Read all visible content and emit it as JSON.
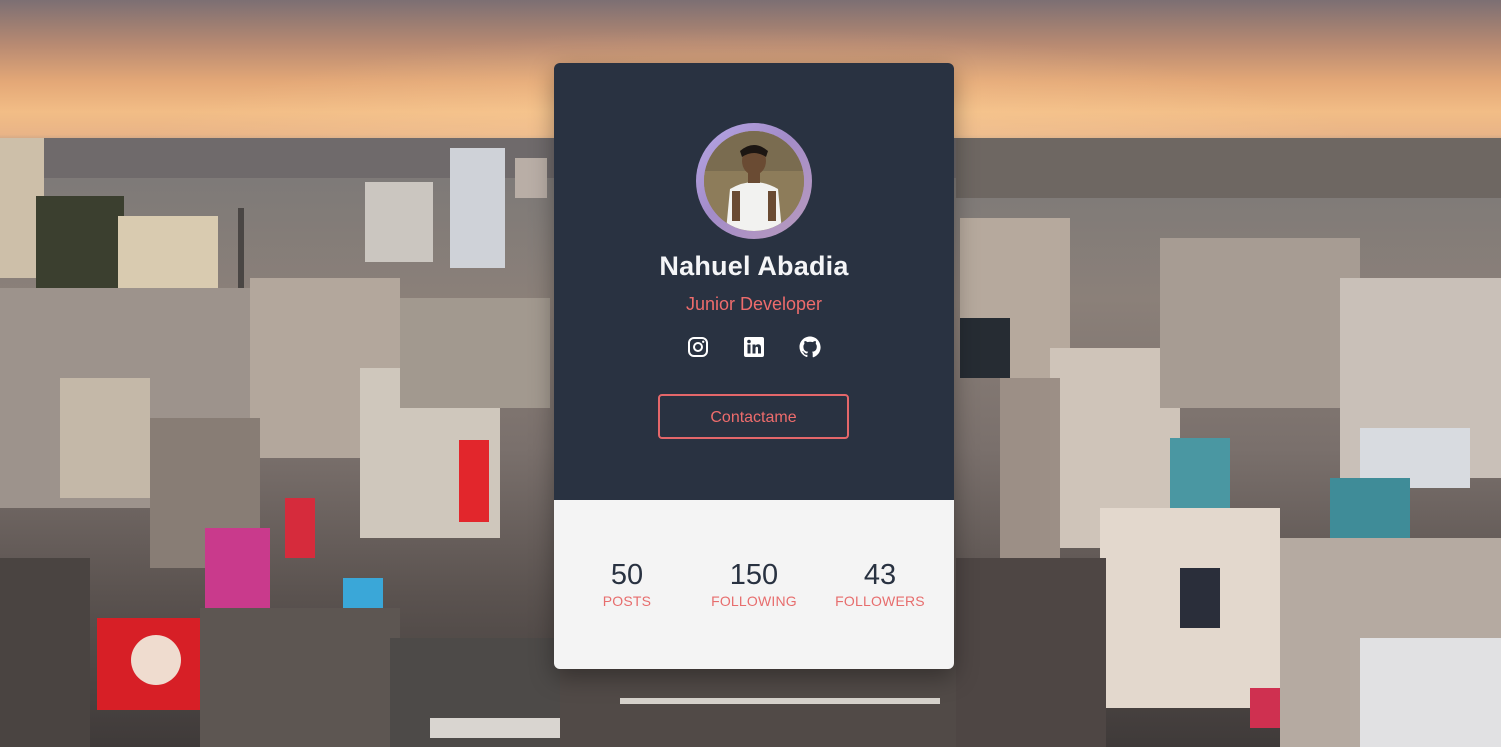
{
  "profile": {
    "name": "Nahuel Abadia",
    "role": "Junior Developer",
    "contact_label": "Contactame"
  },
  "socials": [
    {
      "icon": "instagram-icon"
    },
    {
      "icon": "linkedin-icon"
    },
    {
      "icon": "github-icon"
    }
  ],
  "stats": [
    {
      "value": "50",
      "label": "POSTS"
    },
    {
      "value": "150",
      "label": "FOLLOWING"
    },
    {
      "value": "43",
      "label": "FOLLOWERS"
    }
  ],
  "colors": {
    "card_dark": "#293241",
    "card_light": "#f4f4f4",
    "accent": "#ee6c6c",
    "text_light": "#f4f5f7"
  }
}
